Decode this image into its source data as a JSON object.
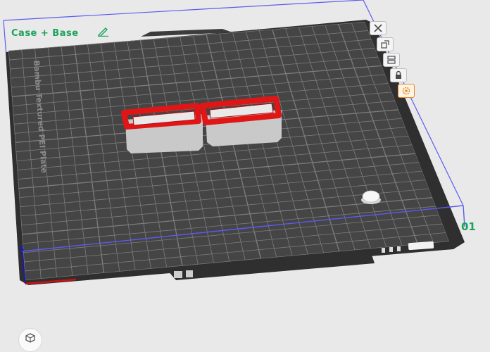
{
  "plate": {
    "name": "Case + Base",
    "number": "01",
    "texture_label": "Bambu Textured PEI Plate"
  },
  "toolbar": {
    "icons": [
      "close-icon",
      "auto-orient-icon",
      "arrange-icon",
      "lock-icon",
      "settings-icon"
    ],
    "active_index": 4
  },
  "colors": {
    "plate_label": "#1aa35b",
    "build_volume_edge": "#5a5cf0",
    "model_top": "#e01616",
    "model_body": "#c8c8c8",
    "plate_surface": "#3f3f3f",
    "grid_line": "#7a7a7a",
    "accent_active": "#e08a2e"
  }
}
